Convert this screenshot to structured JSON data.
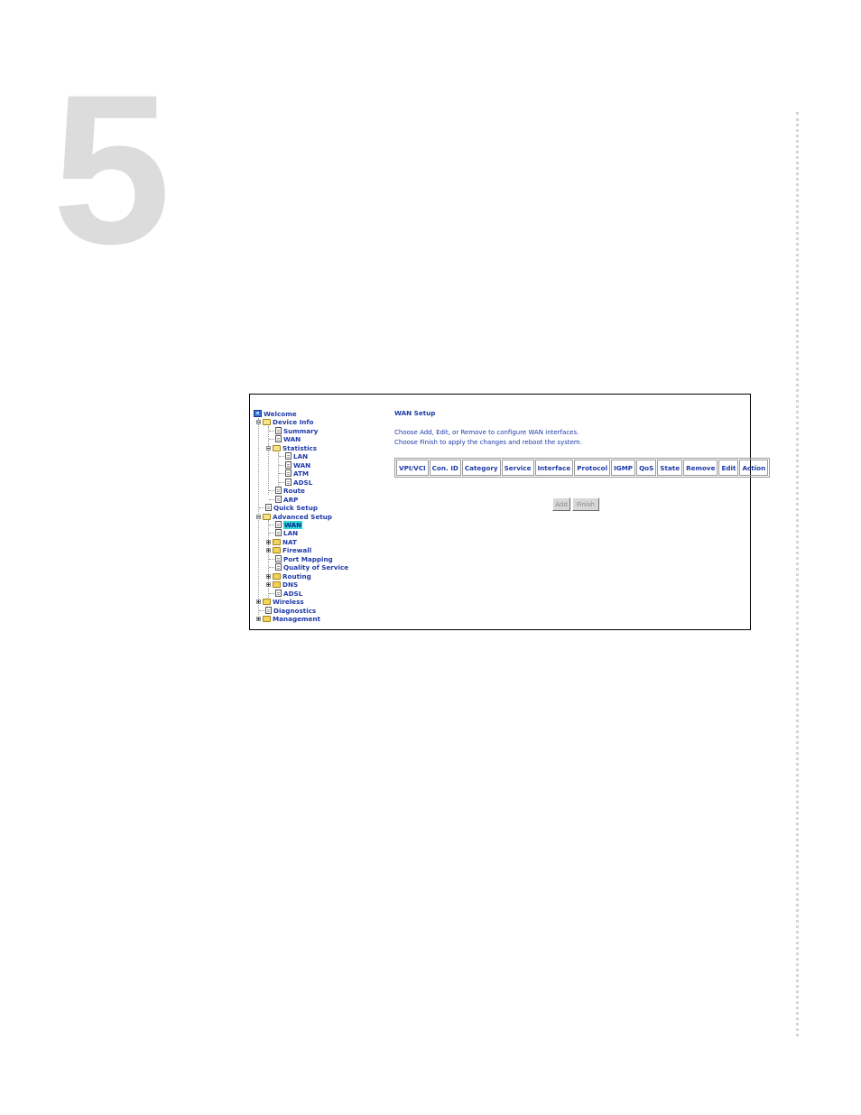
{
  "chapter": {
    "number": "5"
  },
  "nav_tree": {
    "welcome": "Welcome",
    "device_info": "Device Info",
    "summary": "Summary",
    "wan": "WAN",
    "statistics": "Statistics",
    "stat_lan": "LAN",
    "stat_wan": "WAN",
    "stat_atm": "ATM",
    "stat_adsl": "ADSL",
    "route": "Route",
    "arp": "ARP",
    "quick_setup": "Quick Setup",
    "advanced_setup": "Advanced Setup",
    "adv_wan": "WAN",
    "adv_lan": "LAN",
    "nat": "NAT",
    "firewall": "Firewall",
    "port_mapping": "Port Mapping",
    "qos": "Quality of Service",
    "routing": "Routing",
    "dns": "DNS",
    "adsl": "ADSL",
    "wireless": "Wireless",
    "diagnostics": "Diagnostics",
    "management": "Management"
  },
  "wan_setup": {
    "title": "WAN Setup",
    "instruction_1": "Choose Add, Edit, or Remove to configure WAN interfaces.",
    "instruction_2": "Choose Finish to apply the changes and reboot the system.",
    "columns": [
      "VPI/VCI",
      "Con. ID",
      "Category",
      "Service",
      "Interface",
      "Protocol",
      "IGMP",
      "QoS",
      "State",
      "Remove",
      "Edit",
      "Action"
    ],
    "add_label": "Add",
    "finish_label": "Finish"
  },
  "colors": {
    "link_blue": "#1e3aa8",
    "selected_bg": "#2fd7d7",
    "chapter_gray": "#dcdcdc"
  }
}
